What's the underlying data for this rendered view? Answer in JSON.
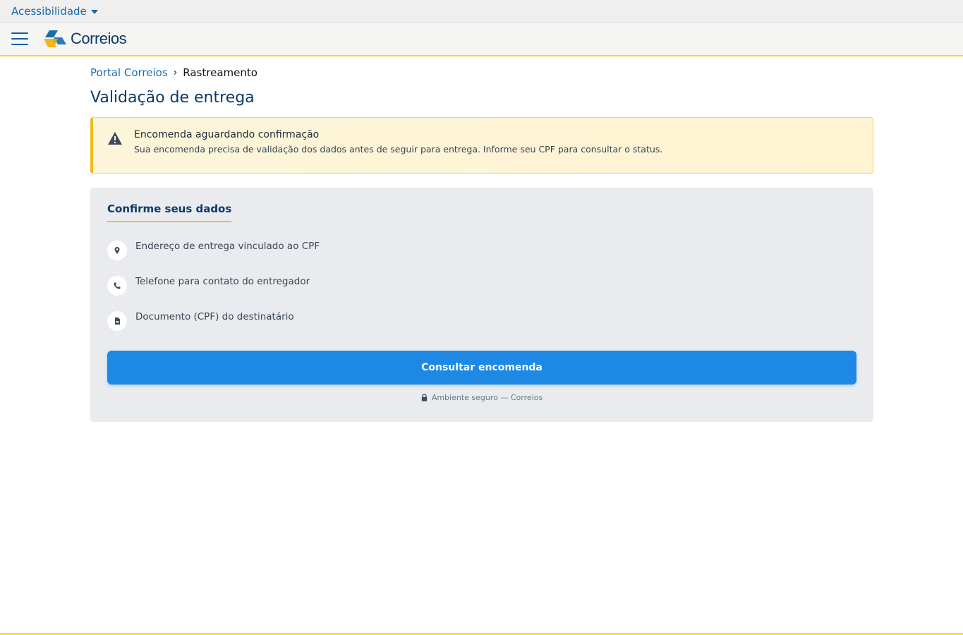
{
  "topbar": {
    "accessibility_label": "Acessibilidade"
  },
  "header": {
    "logo_text": "Correios"
  },
  "breadcrumb": {
    "home": "Portal Correios",
    "separator": "›",
    "current": "Rastreamento"
  },
  "page": {
    "title": "Validação de entrega"
  },
  "alert": {
    "title": "Encomenda aguardando confirmação",
    "text": "Sua encomenda precisa de validação dos dados antes de seguir para entrega. Informe seu CPF para consultar o status."
  },
  "card": {
    "title": "Confirme seus dados",
    "items": [
      {
        "icon": "location-pin-icon",
        "label": "Endereço de entrega vinculado ao CPF"
      },
      {
        "icon": "phone-icon",
        "label": "Telefone para contato do entregador"
      },
      {
        "icon": "document-icon",
        "label": "Documento (CPF) do destinatário"
      }
    ],
    "button_label": "Consultar encomenda",
    "secure_note": "Ambiente seguro — Correios"
  },
  "colors": {
    "brand_blue": "#0b3a67",
    "link_blue": "#1a6bb0",
    "button_blue": "#1e88e5",
    "brand_yellow": "#f1c21b"
  }
}
